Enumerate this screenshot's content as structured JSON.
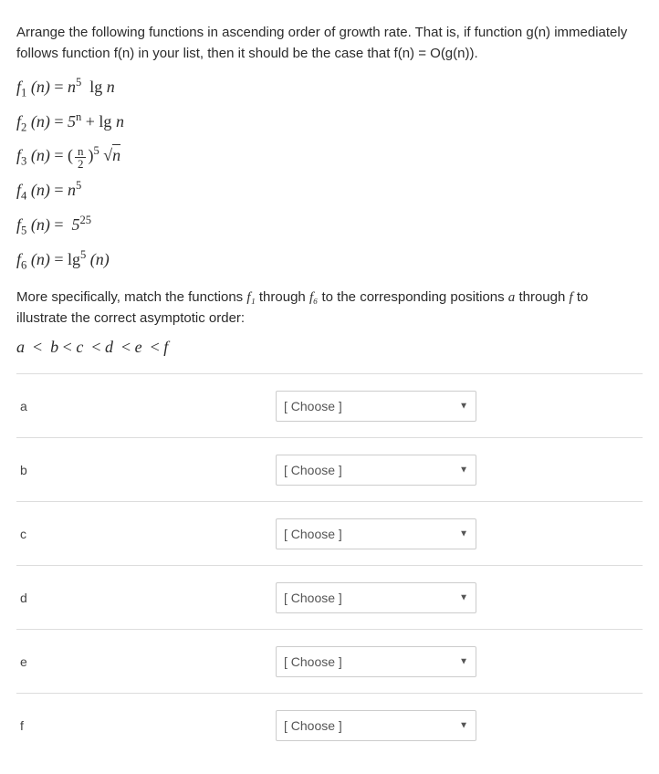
{
  "intro": "Arrange the following functions in ascending order of growth rate. That is, if function g(n) immediately follows function f(n) in your list, then it should be the case that f(n) = O(g(n)).",
  "functions": {
    "f1": "f₁ (n) = n⁵ lg n",
    "f2": "f₂ (n) = 5ⁿ + lg n",
    "f3": "f₃ (n) = (n/2)⁵ √n",
    "f4": "f₄ (n) = n⁵",
    "f5": "f₅ (n) = 5²⁵",
    "f6": "f₆ (n) = lg⁵ (n)"
  },
  "more_prefix": "More specifically, match the functions ",
  "more_mid1": " through ",
  "more_mid2": " to the corresponding positions ",
  "more_mid3": " through ",
  "more_suffix": " to illustrate the correct asymptotic order:",
  "f1_sym": "f₁",
  "f6_sym": "f₆",
  "a_sym": "a",
  "f_sym": "f",
  "order_relation": "a  <  b < c  < d  < e  < f",
  "choose_placeholder": "[ Choose ]",
  "rows": {
    "a": "a",
    "b": "b",
    "c": "c",
    "d": "d",
    "e": "e",
    "f": "f"
  }
}
